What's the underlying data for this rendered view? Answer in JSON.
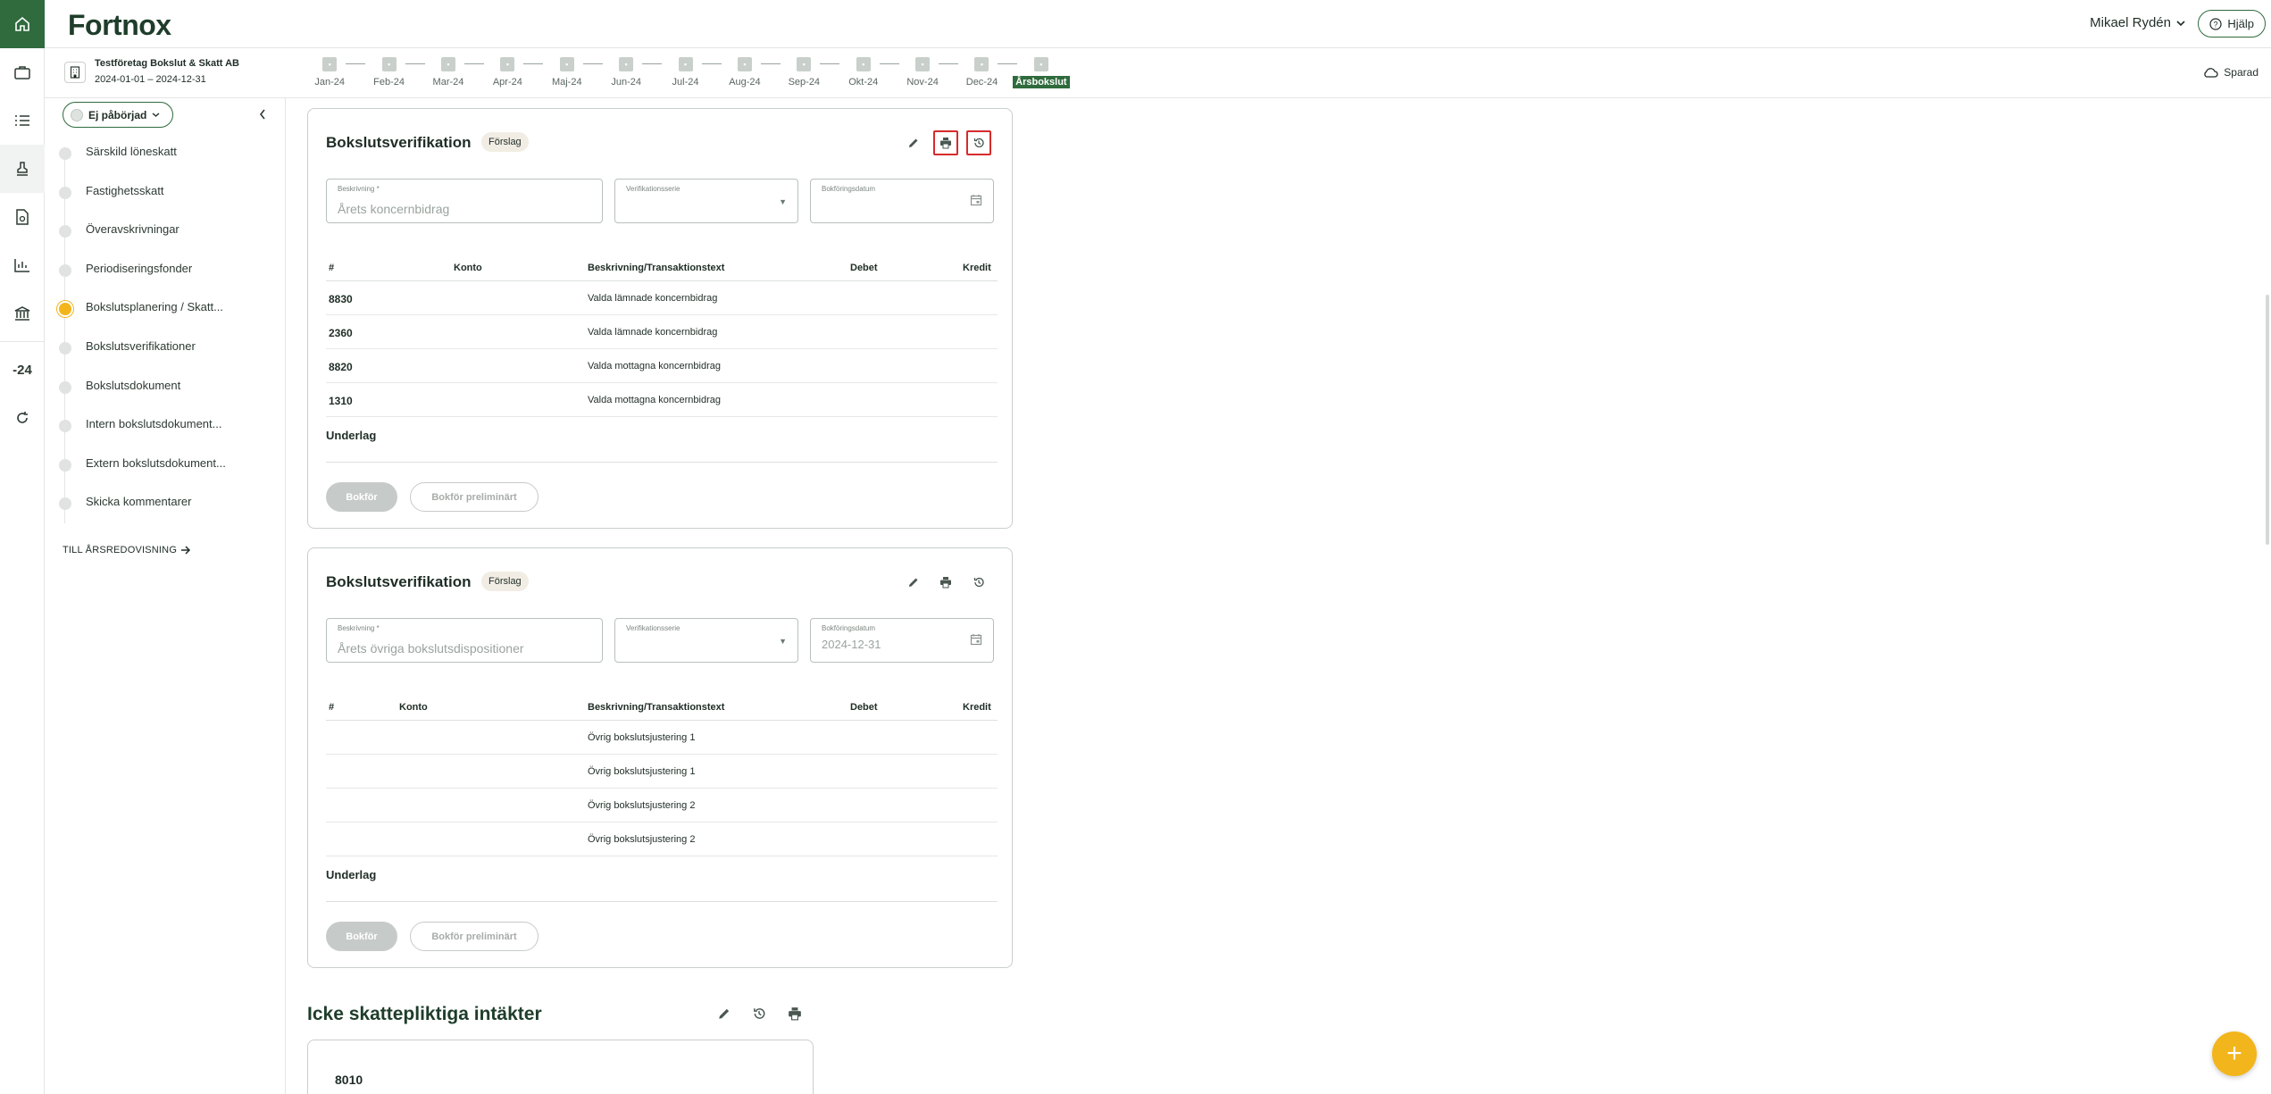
{
  "brand": {
    "logo": "Fortnox",
    "primary_color": "#2f6b3d",
    "accent_color": "#f2b51c",
    "highlight_color": "#d62b2b"
  },
  "rail": {
    "items": [
      "home-icon",
      "briefcase-icon",
      "checklist-icon",
      "stamp-icon",
      "document-icon",
      "chart-icon",
      "bank-icon",
      "year-24",
      "refresh-icon"
    ],
    "year_label": "-24"
  },
  "header": {
    "user_name": "Mikael Rydén",
    "help_label": "Hjälp"
  },
  "company": {
    "name": "Testföretag Bokslut & Skatt AB",
    "period": "2024-01-01 – 2024-12-31"
  },
  "months": [
    "Jan-24",
    "Feb-24",
    "Mar-24",
    "Apr-24",
    "Maj-24",
    "Jun-24",
    "Jul-24",
    "Aug-24",
    "Sep-24",
    "Okt-24",
    "Nov-24",
    "Dec-24",
    "Årsbokslut"
  ],
  "saved_label": "Sparad",
  "sidebar": {
    "status_label": "Ej påbörjad",
    "steps": [
      "Särskild löneskatt",
      "Fastighetsskatt",
      "Överavskrivningar",
      "Periodiseringsfonder",
      "Bokslutsplanering / Skatt...",
      "Bokslutsverifikationer",
      "Bokslutsdokument",
      "Intern bokslutsdokument...",
      "Extern bokslutsdokument...",
      "Skicka kommentarer"
    ],
    "active_step": "Bokslutsplanering / Skatt...",
    "to_annual": "TILL ÅRSREDOVISNING"
  },
  "card1": {
    "title": "Bokslutsverifikation",
    "badge": "Förslag",
    "desc_label": "Beskrivning *",
    "desc_value": "Årets koncernbidrag",
    "series_label": "Verifikationsserie",
    "date_label": "Bokföringsdatum",
    "date_value": "",
    "headers": {
      "num": "#",
      "account": "Konto",
      "desc": "Beskrivning/Transaktionstext",
      "debit": "Debet",
      "credit": "Kredit"
    },
    "rows": [
      {
        "account": "8830",
        "desc": "Valda lämnade koncernbidrag"
      },
      {
        "account": "2360",
        "desc": "Valda lämnade koncernbidrag"
      },
      {
        "account": "8820",
        "desc": "Valda mottagna koncernbidrag"
      },
      {
        "account": "1310",
        "desc": "Valda mottagna koncernbidrag"
      }
    ],
    "underlag": "Underlag",
    "post_label": "Bokför",
    "prelim_label": "Bokför preliminärt"
  },
  "card2": {
    "title": "Bokslutsverifikation",
    "badge": "Förslag",
    "desc_label": "Beskrivning *",
    "desc_value": "Årets övriga bokslutsdispositioner",
    "series_label": "Verifikationsserie",
    "date_label": "Bokföringsdatum",
    "date_value": "2024-12-31",
    "headers": {
      "num": "#",
      "account": "Konto",
      "desc": "Beskrivning/Transaktionstext",
      "debit": "Debet",
      "credit": "Kredit"
    },
    "rows": [
      {
        "account": "",
        "desc": "Övrig bokslutsjustering 1"
      },
      {
        "account": "",
        "desc": "Övrig bokslutsjustering 1"
      },
      {
        "account": "",
        "desc": "Övrig bokslutsjustering 2"
      },
      {
        "account": "",
        "desc": "Övrig bokslutsjustering 2"
      }
    ],
    "underlag": "Underlag",
    "post_label": "Bokför",
    "prelim_label": "Bokför preliminärt"
  },
  "section3": {
    "title": "Icke skattepliktiga intäkter",
    "account": "8010"
  },
  "fab_label": "+"
}
